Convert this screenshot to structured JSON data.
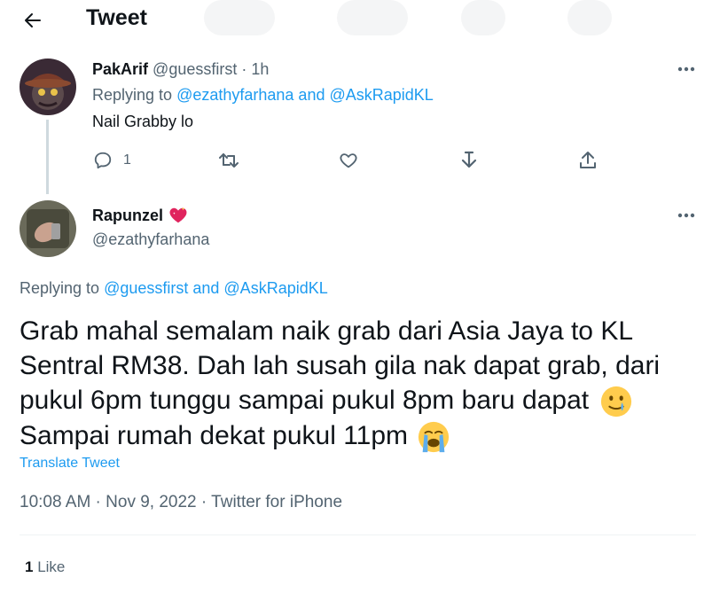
{
  "header": {
    "title": "Tweet",
    "back_icon": "arrow-left-icon"
  },
  "colors": {
    "accent": "#1d9bf0",
    "text": "#0f1419",
    "muted": "#536471",
    "heart": "#e0245e"
  },
  "reply_tweet": {
    "author_name": "PakArif",
    "handle": "@guessfirst",
    "separator": "·",
    "time": "1h",
    "replying_prefix": "Replying to",
    "replying_users": "@ezathyfarhana and @AskRapidKL",
    "text": "Nail Grabby lo",
    "actions": {
      "reply_count": "1"
    }
  },
  "main_tweet": {
    "author_name": "Rapunzel",
    "name_emoji": "heart-sparkle-icon",
    "handle": "@ezathyfarhana",
    "replying_prefix": "Replying to",
    "replying_users": "@guessfirst and @AskRapidKL",
    "text_lines": [
      "Grab mahal semalam naik grab dari Asia Jaya to KL",
      "Sentral RM38. Dah lah susah gila nak dapat grab, dari",
      "pukul 6pm tunggu sampai pukul 8pm baru dapat",
      "Sampai rumah dekat pukul 11pm"
    ],
    "translate_label": "Translate Tweet",
    "timestamp": "10:08 AM · Nov 9, 2022 · Twitter for iPhone",
    "likes_count": "1",
    "likes_label": "Like"
  }
}
